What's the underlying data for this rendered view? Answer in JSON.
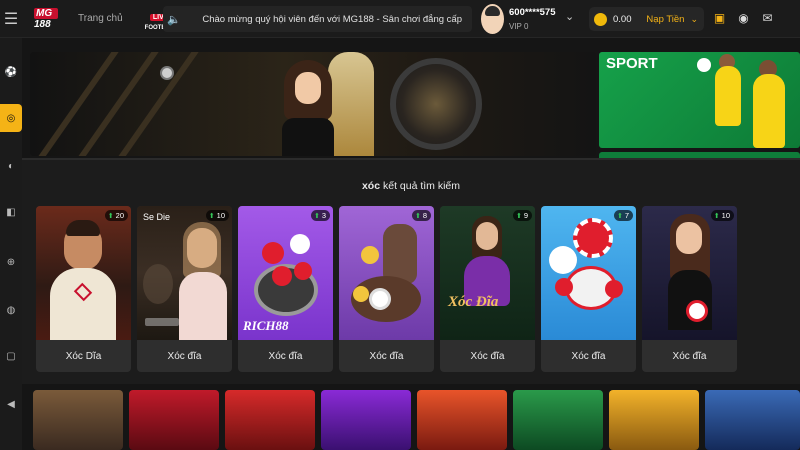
{
  "header": {
    "logo_top": "MG",
    "logo_bottom": "188",
    "home": "Trang chủ",
    "live_label": "LIVE",
    "live_sub": "FOOTBALL",
    "marquee": "Chào mừng quý hội viên đến với MG188 - Sân chơi đẳng cấp",
    "user_name": "600****575",
    "user_vip": "VIP 0",
    "balance": "0.00",
    "deposit": "Nạp Tiền"
  },
  "banner": {
    "sport_title": "SPORT"
  },
  "search": {
    "keyword": "xóc",
    "suffix": " kết quả tìm kiếm"
  },
  "results": [
    {
      "title": "Xóc Dĩa",
      "count": "20",
      "caption": ""
    },
    {
      "title": "Xóc đĩa",
      "count": "10",
      "caption": "Se Die"
    },
    {
      "title": "Xóc đĩa",
      "count": "3",
      "caption": "",
      "brand": "RICH88"
    },
    {
      "title": "Xóc đĩa",
      "count": "8",
      "caption": ""
    },
    {
      "title": "Xóc đĩa",
      "count": "9",
      "caption": "",
      "brand": "Xóc Đĩa"
    },
    {
      "title": "Xóc đĩa",
      "count": "7",
      "caption": ""
    },
    {
      "title": "Xóc đĩa",
      "count": "10",
      "caption": ""
    }
  ],
  "colors": {
    "accent": "#f5b316",
    "live_red": "#d60f2a",
    "badge_green": "#34c759"
  },
  "icons": [
    "menu-icon",
    "speaker-icon",
    "chevron-down-icon",
    "coin-icon",
    "gift-icon",
    "support-icon",
    "mail-icon"
  ]
}
